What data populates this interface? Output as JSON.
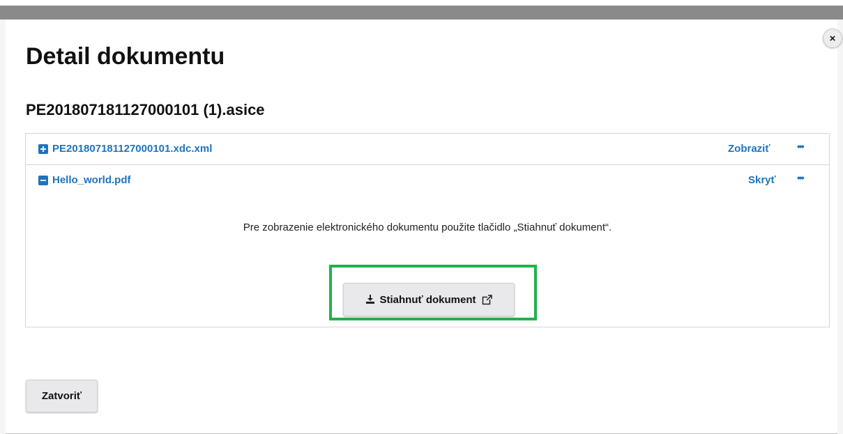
{
  "modal": {
    "title": "Detail dokumentu",
    "subtitle": "PE201807181127000101 (1).asice",
    "close_label": "×"
  },
  "files": [
    {
      "name": "PE201807181127000101.xdc.xml",
      "toggle_icon": "plus-square-icon",
      "action_label": "Zobraziť",
      "more_label": "•••",
      "expanded": false
    },
    {
      "name": "Hello_world.pdf",
      "toggle_icon": "minus-square-icon",
      "action_label": "Skryť",
      "more_label": "•••",
      "expanded": true
    }
  ],
  "expanded_content": {
    "info_text": "Pre zobrazenie elektronického dokumentu použite tlačidlo „Stiahnuť dokument“.",
    "download_button_label": "Stiahnuť dokument",
    "download_icon": "download-icon",
    "external_icon": "external-link-icon"
  },
  "footer": {
    "close_button_label": "Zatvoriť"
  },
  "colors": {
    "link": "#1e73be",
    "highlight": "#22b14c",
    "button_bg": "#e9e9ec"
  }
}
